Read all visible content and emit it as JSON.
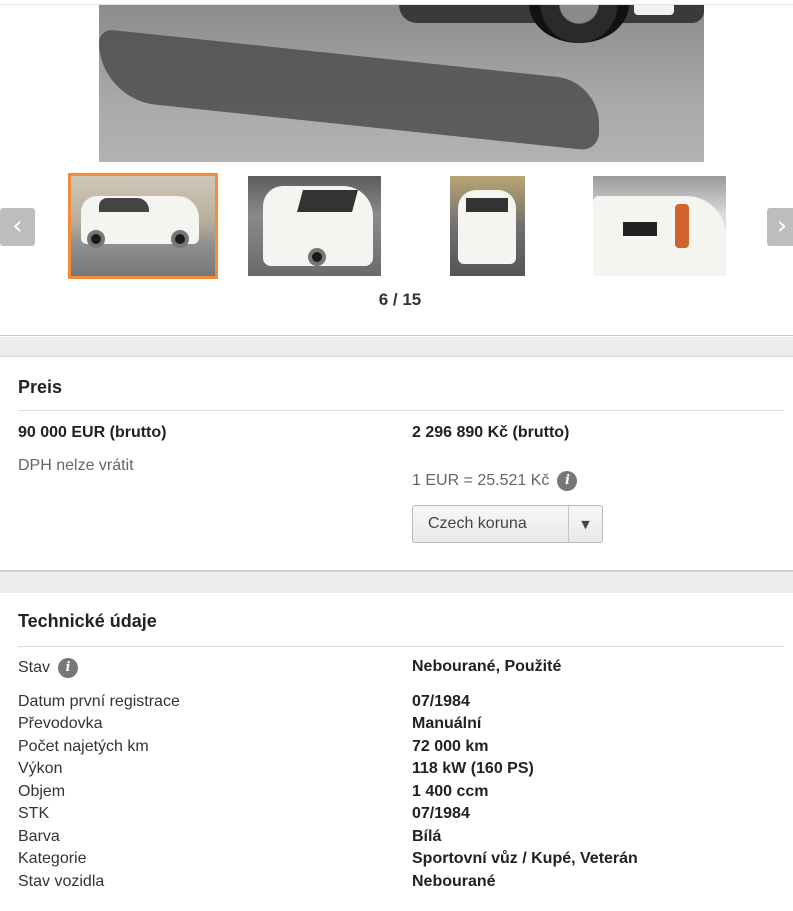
{
  "gallery": {
    "counter": "6 / 15",
    "prev_arrow": "‹",
    "next_arrow": "›",
    "thumbnails": [
      "thumb-1",
      "thumb-2",
      "thumb-3",
      "thumb-4"
    ],
    "active_thumbnail_index": 0,
    "active_border_color": "#ef8c3e"
  },
  "price": {
    "title": "Preis",
    "eur_price": "90 000 EUR (brutto)",
    "czk_price": "2 296 890 Kč (brutto)",
    "vat_note": "DPH nelze vrátit",
    "exchange_rate": "1 EUR = 25.521 Kč",
    "info_icon": "i",
    "currency_select": {
      "value": "Czech koruna",
      "caret": "▼"
    }
  },
  "tech": {
    "title": "Technické údaje",
    "info_icon": "i",
    "rows": [
      {
        "label": "Stav",
        "value": "Nebourané, Použité"
      },
      {
        "label": "Datum první registrace",
        "value": "07/1984"
      },
      {
        "label": "Převodovka",
        "value": "Manuální"
      },
      {
        "label": "Počet najetých km",
        "value": "72 000 km"
      },
      {
        "label": "Výkon",
        "value": "118 kW (160 PS)"
      },
      {
        "label": "Objem",
        "value": "1 400 ccm"
      },
      {
        "label": "STK",
        "value": "07/1984"
      },
      {
        "label": "Barva",
        "value": "Bílá"
      },
      {
        "label": "Kategorie",
        "value": "Sportovní vůz / Kupé, Veterán"
      },
      {
        "label": "Stav vozidla",
        "value": "Nebourané"
      }
    ]
  }
}
